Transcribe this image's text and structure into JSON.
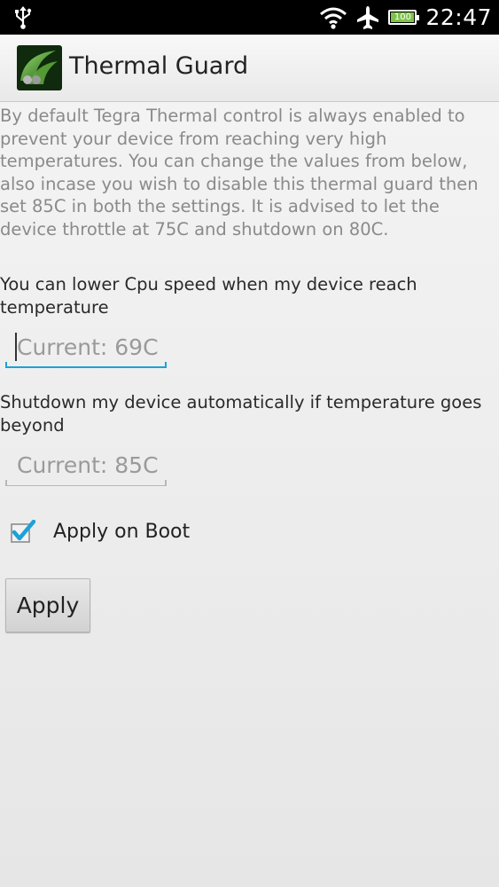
{
  "status_bar": {
    "time": "22:47",
    "battery_level": "100",
    "icons": [
      "usb-icon",
      "wifi-icon",
      "airplane-icon",
      "battery-icon"
    ]
  },
  "app": {
    "title": "Thermal Guard",
    "icon": "thermal-guard-app-icon"
  },
  "main": {
    "intro_text": "By default Tegra Thermal control is always enabled to prevent your device from reaching very high temperatures. You can change the values from below, also incase you wish to disable this thermal guard then set 85C in both the settings. It is advised to let the device throttle at 75C and shutdown on 80C.",
    "throttle_label": "You can lower Cpu speed when my device reach temperature",
    "throttle_placeholder": "Current: 69C",
    "shutdown_label": "Shutdown my device automatically if temperature goes beyond",
    "shutdown_placeholder": "Current: 85C",
    "apply_on_boot_label": "Apply on Boot",
    "apply_on_boot_checked": true,
    "apply_button_label": "Apply"
  },
  "colors": {
    "accent": "#1ba2d6",
    "intro_text": "#8a8a8a",
    "status_bar": "#000000"
  }
}
